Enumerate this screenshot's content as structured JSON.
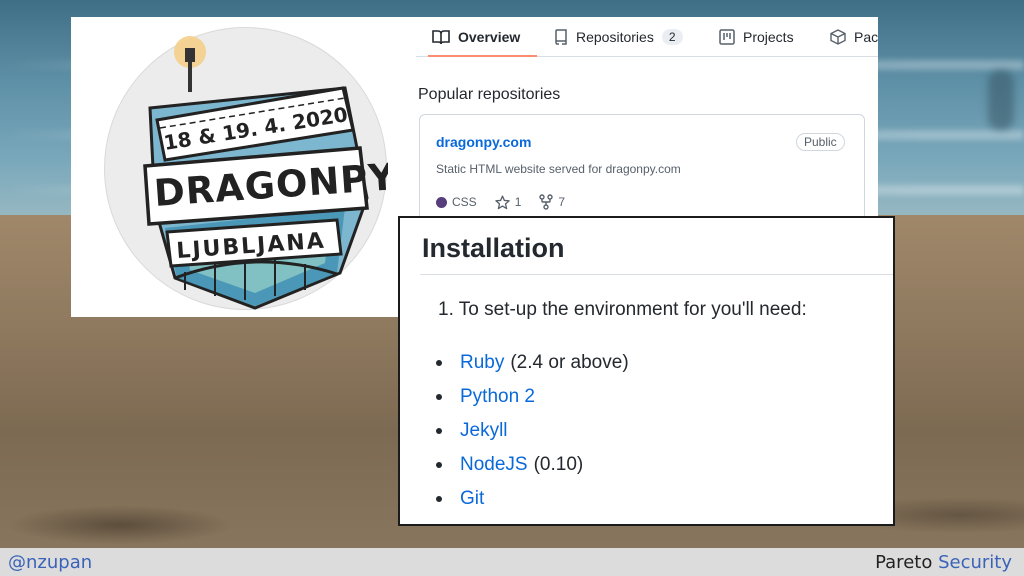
{
  "profile": {
    "avatar_lines": [
      "18 & 19. 4. 2020",
      "DRAGONPY",
      "LJUBLJANA"
    ],
    "tabs": [
      {
        "label": "Overview",
        "icon": "book-icon",
        "active": true
      },
      {
        "label": "Repositories",
        "icon": "repo-icon",
        "count": "2"
      },
      {
        "label": "Projects",
        "icon": "project-board-icon"
      },
      {
        "label": "Pac",
        "icon": "package-icon"
      }
    ],
    "popular_title": "Popular repositories",
    "repo": {
      "name": "dragonpy.com",
      "visibility": "Public",
      "description": "Static HTML website served for dragonpy.com",
      "language": "CSS",
      "language_color": "#563d7c",
      "stars": "1",
      "forks": "7"
    }
  },
  "installation": {
    "heading": "Installation",
    "step": "1. To set-up the environment for you'll need:",
    "requirements": [
      {
        "name": "Ruby",
        "note": "(2.4 or above)"
      },
      {
        "name": "Python 2",
        "note": ""
      },
      {
        "name": "Jekyll",
        "note": ""
      },
      {
        "name": "NodeJS",
        "note": "(0.10)"
      },
      {
        "name": "Git",
        "note": ""
      }
    ],
    "link_color": "#0969da"
  },
  "footer": {
    "handle": "@nzupan",
    "brand_first": "Pareto",
    "brand_second": "Security"
  }
}
